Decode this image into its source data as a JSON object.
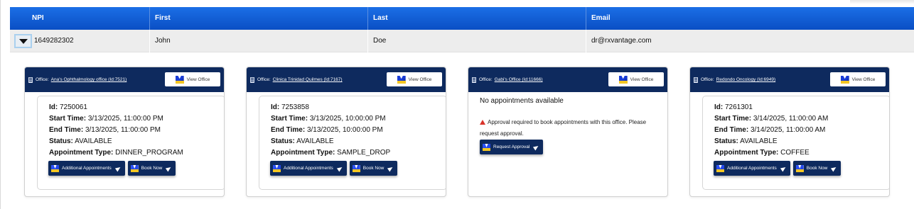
{
  "grid": {
    "columns": [
      "NPI",
      "First",
      "Last",
      "Email"
    ],
    "row": {
      "npi": "1649282302",
      "first": "John",
      "last": "Doe",
      "email": "dr@rxvantage.com"
    }
  },
  "office_label": "Office:",
  "view_office_label": "View Office",
  "offices": [
    {
      "name": "Ana's Ophthalmology office (Id:7521)",
      "appointment": {
        "id": "7250061",
        "start": "3/13/2025, 11:00:00 PM",
        "end": "3/13/2025, 11:00:00 PM",
        "status": "AVAILABLE",
        "type": "DINNER_PROGRAM"
      }
    },
    {
      "name": "Clinica Trinidad Quilmes (Id:7167)",
      "appointment": {
        "id": "7253858",
        "start": "3/13/2025, 10:00:00 PM",
        "end": "3/13/2025, 10:00:00 PM",
        "status": "AVAILABLE",
        "type": "SAMPLE_DROP"
      }
    },
    {
      "name": "Gabi's Office (Id:11666)",
      "no_appointments": "No appointments available",
      "approval_message": "Approval required to book appointments with this office. Please request approval.",
      "request_label": "Request Approval"
    },
    {
      "name": "Redondo Oncology (Id:6949)",
      "appointment": {
        "id": "7261301",
        "start": "3/14/2025, 11:00:00 AM",
        "end": "3/14/2025, 11:00:00 AM",
        "status": "AVAILABLE",
        "type": "COFFEE"
      }
    }
  ],
  "labels": {
    "id": "Id:",
    "start": "Start Time:",
    "end": "End Time:",
    "status": "Status:",
    "type": "Appointment Type:",
    "additional": "Additional Appointments",
    "book": "Book Now"
  },
  "colors": {
    "header_blue": "#0a4fc4",
    "card_navy": "#0e2a5e",
    "logo_blue": "#1a3dd6",
    "logo_yellow": "#f3c623",
    "warning_red": "#d9342b"
  }
}
